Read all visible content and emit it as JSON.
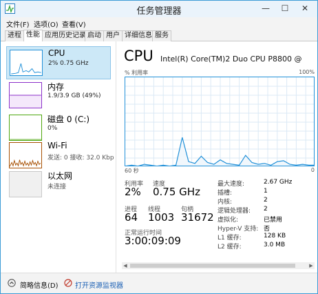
{
  "window": {
    "title": "任务管理器",
    "min_glyph": "—",
    "max_glyph": "☐",
    "close_glyph": "✕"
  },
  "menu": [
    "文件(F)",
    "选项(O)",
    "查看(V)"
  ],
  "tabs": [
    "进程",
    "性能",
    "应用历史记录",
    "启动",
    "用户",
    "详细信息",
    "服务"
  ],
  "active_tab": "性能",
  "sidebar": [
    {
      "name": "CPU",
      "detail": "2% 0.75 GHz",
      "color": "#1e8fd8"
    },
    {
      "name": "内存",
      "detail": "1.9/3.9 GB (49%)",
      "color": "#8b2fc9"
    },
    {
      "name": "磁盘 0 (C:)",
      "detail": "0%",
      "color": "#4da60c"
    },
    {
      "name": "Wi-Fi",
      "detail": "发送: 0 接收: 32.0 Kbp",
      "color": "#a74f01"
    },
    {
      "name": "以太网",
      "detail": "未连接",
      "color": "#a0a0a0"
    }
  ],
  "main": {
    "title": "CPU",
    "model": "Intel(R) Core(TM)2 Duo CPU P8800 @",
    "util_label": "% 利用率",
    "max_label": "100%",
    "time_label": "60 秒",
    "zero_label": "0",
    "utilization_label": "利用率",
    "utilization": "2%",
    "speed_label": "速度",
    "speed": "0.75 GHz",
    "processes_label": "进程",
    "processes": "64",
    "threads_label": "线程",
    "threads": "1003",
    "handles_label": "句柄",
    "handles": "31672",
    "uptime_label": "正常运行时间",
    "uptime": "3:00:09:09",
    "specs": [
      {
        "key": "最大速度:",
        "value": "2.67 GHz"
      },
      {
        "key": "插槽:",
        "value": "1"
      },
      {
        "key": "内核:",
        "value": "2"
      },
      {
        "key": "逻辑处理器:",
        "value": "2"
      },
      {
        "key": "虚拟化:",
        "value": "已禁用"
      },
      {
        "key": "Hyper-V 支持:",
        "value": "否"
      },
      {
        "key": "L1 缓存:",
        "value": "128 KB"
      },
      {
        "key": "L2 缓存:",
        "value": "3.0 MB"
      }
    ]
  },
  "footer": {
    "summary": "简略信息(D)",
    "monitor": "打开资源监视器"
  },
  "colors": {
    "accent": "#1e8fd8",
    "selected": "#cce8f7"
  },
  "chart_data": {
    "type": "line",
    "x": [
      60,
      58,
      56,
      54,
      52,
      50,
      48,
      46,
      44,
      42,
      40,
      38,
      36,
      34,
      32,
      30,
      28,
      26,
      24,
      22,
      20,
      18,
      16,
      14,
      12,
      10,
      8,
      6,
      4,
      2,
      0
    ],
    "values": [
      1,
      2,
      1,
      3,
      2,
      1,
      2,
      1,
      2,
      33,
      6,
      4,
      12,
      5,
      3,
      8,
      4,
      3,
      2,
      13,
      5,
      3,
      4,
      2,
      6,
      7,
      3,
      2,
      3,
      2,
      2
    ],
    "ylim": [
      0,
      100
    ]
  }
}
